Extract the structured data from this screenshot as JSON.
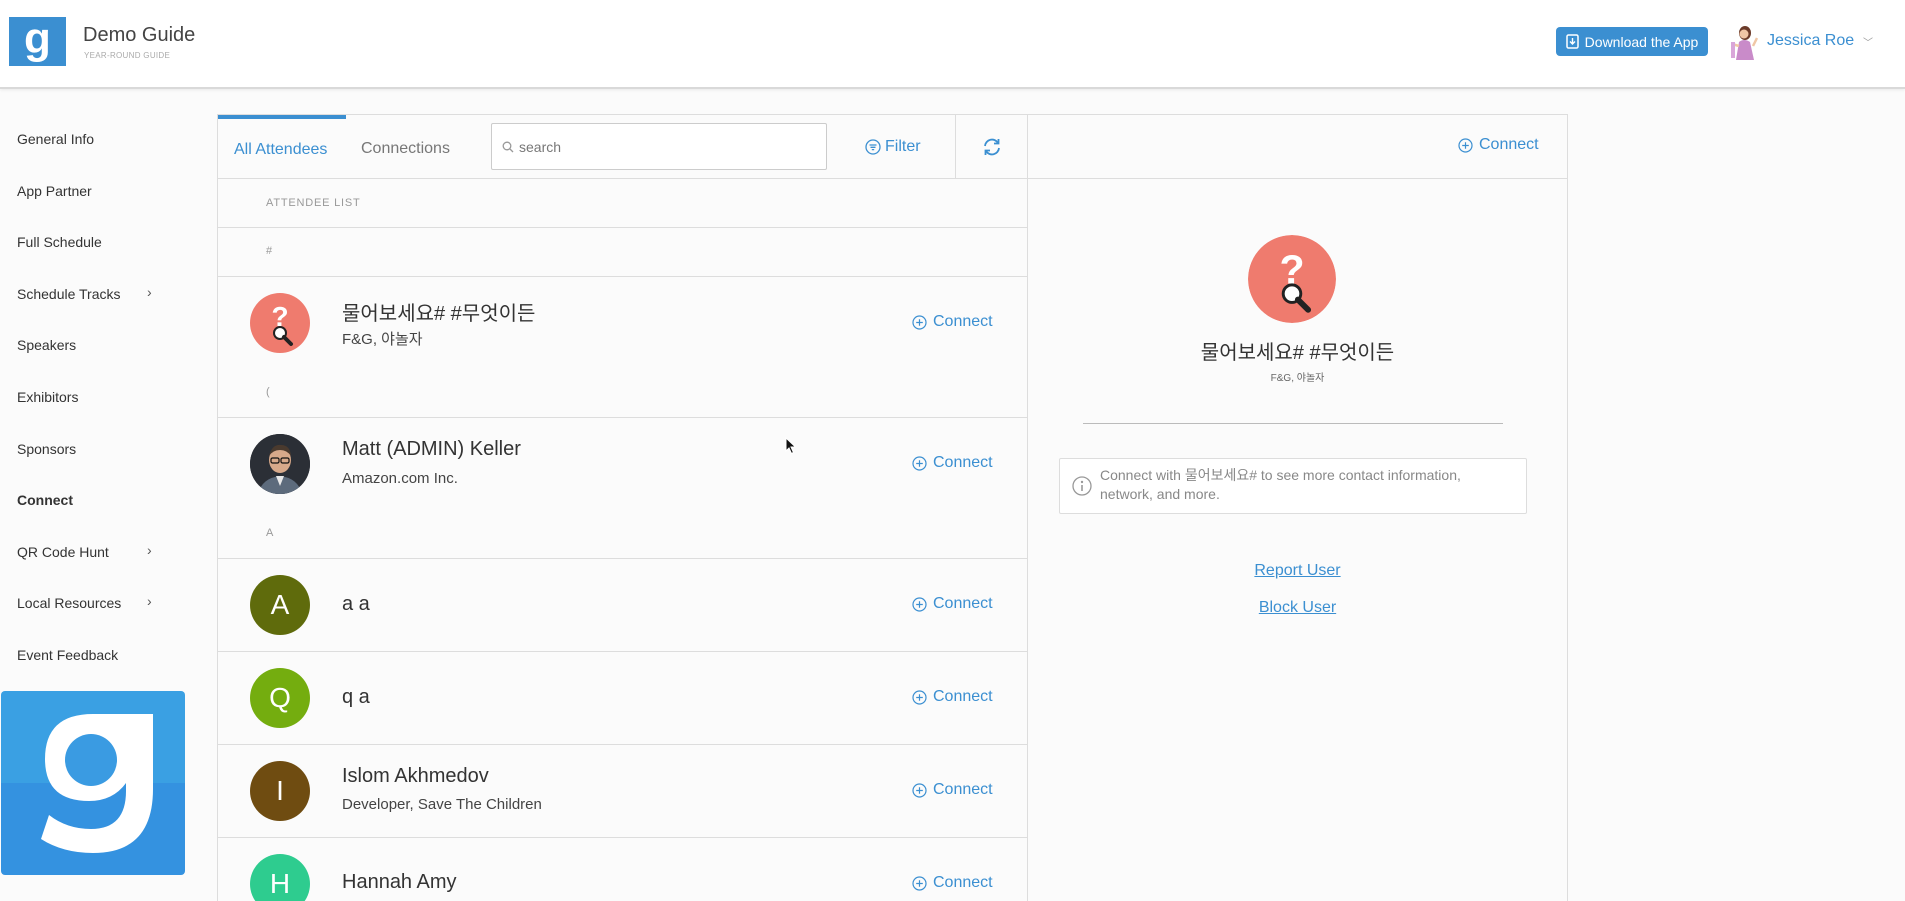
{
  "header": {
    "logo_letter": "g",
    "title": "Demo Guide",
    "subtitle": "YEAR-ROUND GUIDE",
    "download_label": "Download the App",
    "user_name": "Jessica Roe",
    "user_caret": "﹀"
  },
  "sidebar": {
    "items": [
      {
        "label": "General Info",
        "active": false,
        "chevron": false
      },
      {
        "label": "App Partner",
        "active": false,
        "chevron": false
      },
      {
        "label": "Full Schedule",
        "active": false,
        "chevron": false
      },
      {
        "label": "Schedule Tracks",
        "active": false,
        "chevron": true
      },
      {
        "label": "Speakers",
        "active": false,
        "chevron": false
      },
      {
        "label": "Exhibitors",
        "active": false,
        "chevron": false
      },
      {
        "label": "Sponsors",
        "active": false,
        "chevron": false
      },
      {
        "label": "Connect",
        "active": true,
        "chevron": false
      },
      {
        "label": "QR Code Hunt",
        "active": false,
        "chevron": true
      },
      {
        "label": "Local Resources",
        "active": false,
        "chevron": true
      },
      {
        "label": "Event Feedback",
        "active": false,
        "chevron": false
      }
    ],
    "chevron_glyph": "›"
  },
  "main": {
    "tabs": [
      {
        "label": "All Attendees",
        "active": true
      },
      {
        "label": "Connections",
        "active": false
      }
    ],
    "search_placeholder": "search",
    "filter_label": "Filter",
    "list_header": "ATTENDEE LIST",
    "connect_label": "Connect",
    "sections": [
      "#",
      "(",
      "A"
    ],
    "attendees": [
      {
        "name": "물어보세요# #무엇이든",
        "subtitle": "F&G, 야놀자",
        "initial": "",
        "color": "#ef7b6e",
        "avatar_type": "question-icon"
      },
      {
        "name": "Matt (ADMIN) Keller",
        "subtitle": "Amazon.com Inc.",
        "initial": "",
        "color": "#2b2f36",
        "avatar_type": "photo"
      },
      {
        "name": "a a",
        "subtitle": "",
        "initial": "A",
        "color": "#5f6b0c",
        "avatar_type": "initial"
      },
      {
        "name": "q a",
        "subtitle": "",
        "initial": "Q",
        "color": "#74ad0f",
        "avatar_type": "initial"
      },
      {
        "name": "Islom Akhmedov",
        "subtitle": "Developer, Save The Children",
        "initial": "I",
        "color": "#6f4c11",
        "avatar_type": "initial"
      },
      {
        "name": "Hannah Amy",
        "subtitle": "",
        "initial": "H",
        "color": "#2ecc8f",
        "avatar_type": "initial"
      }
    ]
  },
  "detail": {
    "connect_label": "Connect",
    "name": "물어보세요# #무엇이든",
    "subtitle": "F&G, 야놀자",
    "info_text": "Connect with 물어보세요# to see more contact information, network, and more.",
    "report_label": "Report User",
    "block_label": "Block User"
  },
  "colors": {
    "accent": "#3b8fd1",
    "question_avatar": "#ef7b6e"
  }
}
